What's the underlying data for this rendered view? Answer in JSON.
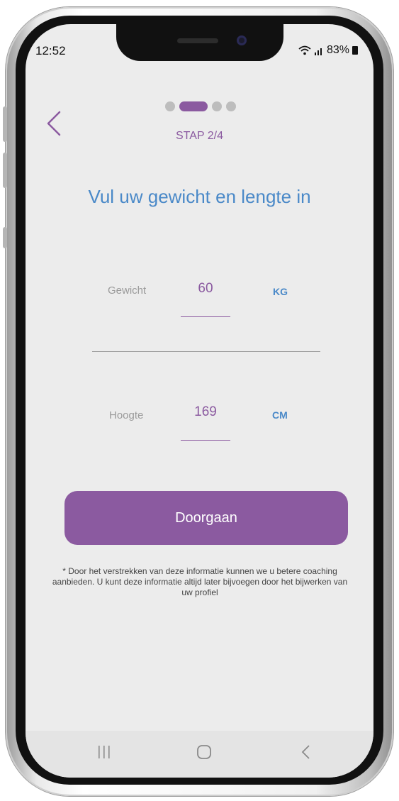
{
  "status_bar": {
    "time": "12:52",
    "battery": "83%"
  },
  "progress": {
    "total_steps": 4,
    "current_step": 2,
    "step_label": "STAP 2/4"
  },
  "page": {
    "title": "Vul uw gewicht en lengte in"
  },
  "weight": {
    "label": "Gewicht",
    "value": "60",
    "unit": "KG"
  },
  "height": {
    "label": "Hoogte",
    "value": "169",
    "unit": "CM"
  },
  "actions": {
    "continue_label": "Doorgaan"
  },
  "footnote": "* Door het verstrekken van deze informatie kunnen we u betere coaching aanbieden. U kunt deze informatie altijd later bijvoegen door het bijwerken van uw profiel",
  "colors": {
    "accent": "#8b5aa0",
    "title": "#4a89c8",
    "background": "#ececec"
  },
  "icons": [
    "back-chevron-icon",
    "wifi-icon",
    "signal-icon",
    "battery-icon",
    "recents-icon",
    "home-icon",
    "nav-back-icon"
  ]
}
